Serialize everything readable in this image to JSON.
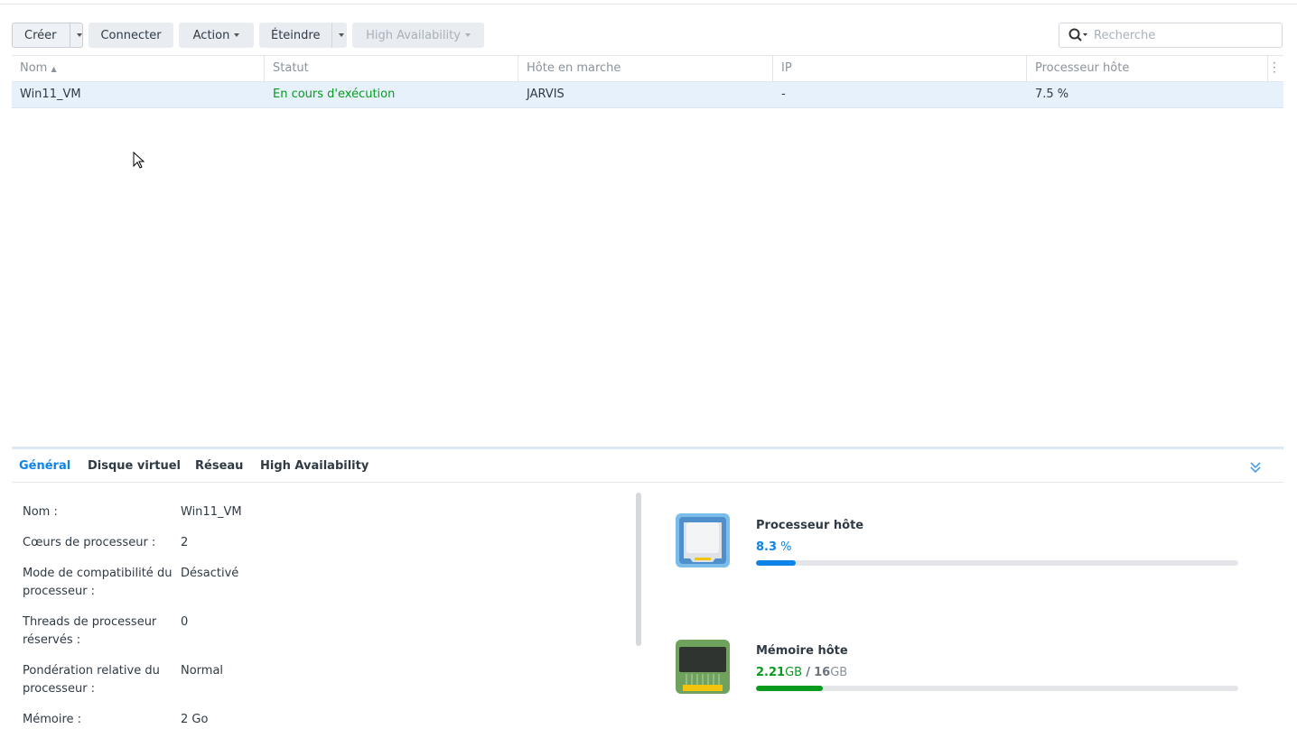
{
  "toolbar": {
    "create": "Créer",
    "connect": "Connecter",
    "action": "Action",
    "shutdown": "Éteindre",
    "high_availability": "High Availability",
    "search_placeholder": "Recherche"
  },
  "table": {
    "columns": [
      "Nom",
      "Statut",
      "Hôte en marche",
      "IP",
      "Processeur hôte"
    ],
    "rows": [
      {
        "name": "Win11_VM",
        "status": "En cours d'exécution",
        "host": "JARVIS",
        "ip": "-",
        "cpu": "7.5 %"
      }
    ]
  },
  "details": {
    "tabs": [
      "Général",
      "Disque virtuel",
      "Réseau",
      "High Availability"
    ],
    "general": [
      {
        "label": "Nom :",
        "value": "Win11_VM"
      },
      {
        "label": "Cœurs de processeur :",
        "value": "2"
      },
      {
        "label": "Mode de compatibilité du processeur :",
        "value": "Désactivé"
      },
      {
        "label": "Threads de processeur réservés :",
        "value": "0"
      },
      {
        "label": "Pondération relative du processeur :",
        "value": "Normal"
      },
      {
        "label": "Mémoire :",
        "value": "2 Go"
      }
    ],
    "cpu": {
      "title": "Processeur hôte",
      "value": "8.3",
      "unit": "%",
      "percent": 8.3,
      "color": "#0d84e5"
    },
    "memory": {
      "title": "Mémoire hôte",
      "used": "2.21",
      "used_unit": "GB",
      "sep": "/",
      "total": "16",
      "total_unit": "GB",
      "percent": 13.8,
      "color": "#0a9a1e"
    }
  }
}
